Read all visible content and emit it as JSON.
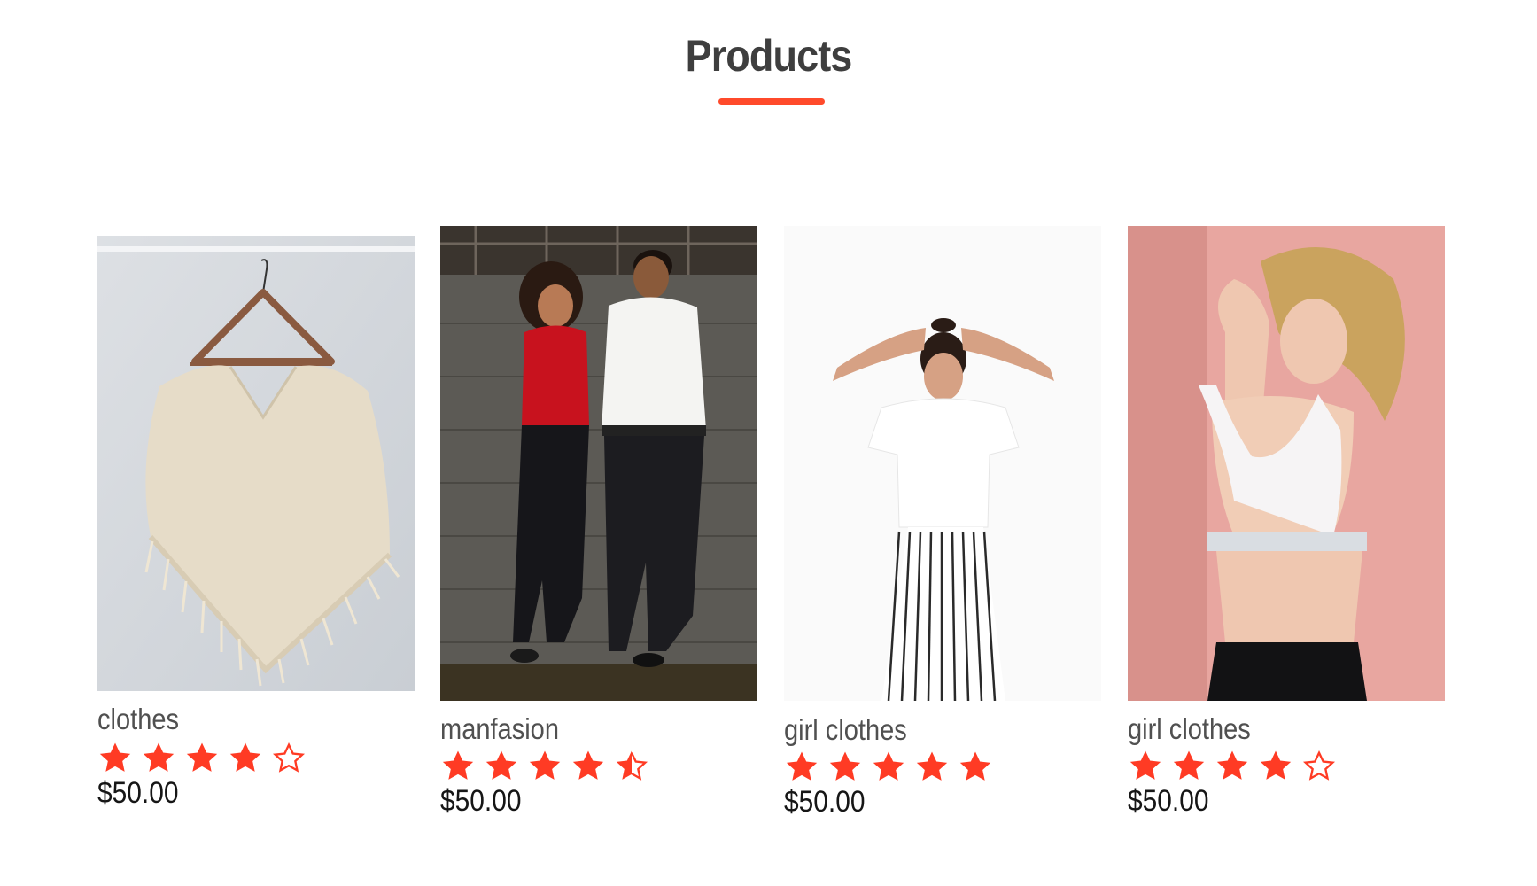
{
  "section": {
    "title": "Products",
    "accent_color": "#ff4a2b"
  },
  "products": [
    {
      "name": "clothes",
      "rating": 4,
      "rating_max": 5,
      "price": "$50.00",
      "image": "knitted-poncho-on-hanger"
    },
    {
      "name": "manfasion",
      "rating": 4.5,
      "rating_max": 5,
      "price": "$50.00",
      "image": "couple-leaning-on-wall"
    },
    {
      "name": "girl clothes",
      "rating": 5,
      "rating_max": 5,
      "price": "$50.00",
      "image": "woman-white-tshirt-striped-pants"
    },
    {
      "name": "girl clothes",
      "rating": 4,
      "rating_max": 5,
      "price": "$50.00",
      "image": "woman-sports-bra-pink-wall"
    }
  ]
}
